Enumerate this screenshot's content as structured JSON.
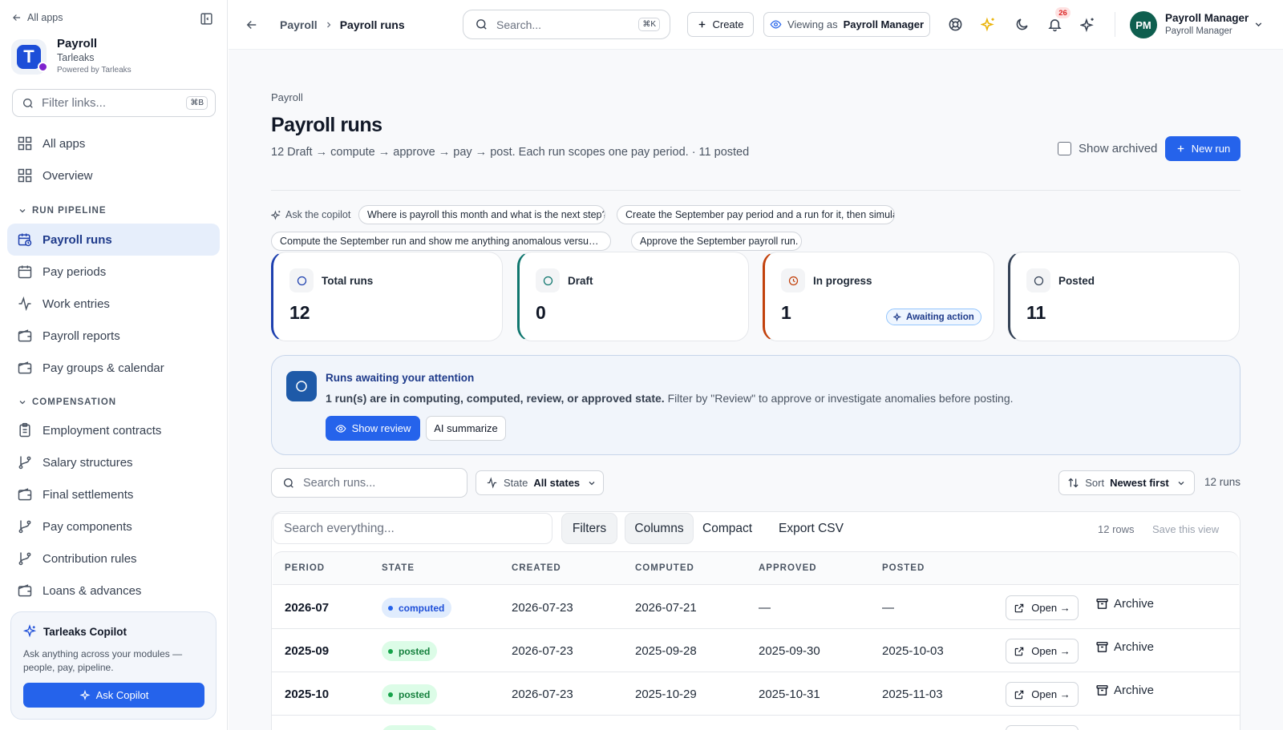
{
  "sidebar": {
    "back_label": "All apps",
    "app_name": "Payroll",
    "org_name": "Tarleaks",
    "powered_by": "Powered by Tarleaks",
    "filter_placeholder": "Filter links...",
    "filter_shortcut": "⌘B",
    "top_items": [
      {
        "label": "All apps"
      },
      {
        "label": "Overview"
      }
    ],
    "sections": [
      {
        "title": "RUN PIPELINE",
        "items": [
          {
            "label": "Payroll runs"
          },
          {
            "label": "Pay periods"
          },
          {
            "label": "Work entries"
          },
          {
            "label": "Payroll reports"
          },
          {
            "label": "Pay groups & calendar"
          }
        ]
      },
      {
        "title": "COMPENSATION",
        "items": [
          {
            "label": "Employment contracts"
          },
          {
            "label": "Salary structures"
          },
          {
            "label": "Final settlements"
          },
          {
            "label": "Pay components"
          },
          {
            "label": "Contribution rules"
          },
          {
            "label": "Loans & advances"
          }
        ]
      }
    ],
    "copilot": {
      "title": "Tarleaks Copilot",
      "description": "Ask anything across your modules — people, pay, pipeline.",
      "button": "Ask Copilot"
    }
  },
  "topbar": {
    "breadcrumb": [
      "Payroll",
      "Payroll runs"
    ],
    "search_placeholder": "Search...",
    "search_shortcut": "⌘K",
    "create_label": "Create",
    "viewing_as_label": "Viewing as",
    "viewing_as_role": "Payroll Manager",
    "notification_count": "26",
    "user": {
      "initials": "PM",
      "name": "Payroll Manager",
      "role": "Payroll Manager"
    }
  },
  "page": {
    "eyebrow": "Payroll",
    "title": "Payroll runs",
    "subtitle": "12 Draft → compute → approve → pay → post. Each run scopes one pay period. · 11 posted",
    "show_archived_label": "Show archived",
    "new_run_label": "New run"
  },
  "copilot_prompts": {
    "label": "Ask the copilot",
    "chips": [
      "Where is payroll this month and what is the next step?",
      "Create the September pay period and a run for it, then simulate.",
      "Compute the September run and show me anything anomalous versus August.",
      "Approve the September payroll run."
    ]
  },
  "stats": [
    {
      "label": "Total runs",
      "value": "12",
      "color": "#1e40af"
    },
    {
      "label": "Draft",
      "value": "0",
      "color": "#0f766e"
    },
    {
      "label": "In progress",
      "value": "1",
      "color": "#c2410c",
      "badge": "Awaiting action"
    },
    {
      "label": "Posted",
      "value": "11",
      "color": "#334155"
    }
  ],
  "attention": {
    "title": "Runs awaiting your attention",
    "bold_text": "1 run(s) are in computing, computed, review, or approved state.",
    "text": " Filter by \"Review\" to approve or investigate anomalies before posting.",
    "show_review": "Show review",
    "ai_summarize": "AI summarize"
  },
  "toolbar": {
    "search_placeholder": "Search runs...",
    "state_label": "State",
    "state_value": "All states",
    "sort_label": "Sort",
    "sort_value": "Newest first",
    "count": "12 runs"
  },
  "table": {
    "search_placeholder": "Search everything...",
    "filters": "Filters",
    "columns_btn": "Columns",
    "compact": "Compact",
    "export": "Export CSV",
    "row_count": "12 rows",
    "save_view": "Save this view",
    "columns": [
      "PERIOD",
      "STATE",
      "CREATED",
      "COMPUTED",
      "APPROVED",
      "POSTED"
    ],
    "open_label": "Open →",
    "archive_label": "Archive",
    "rows": [
      {
        "period": "2026-07",
        "state": "computed",
        "created": "2026-07-23",
        "computed": "2026-07-21",
        "approved": "—",
        "posted": "—"
      },
      {
        "period": "2025-09",
        "state": "posted",
        "created": "2026-07-23",
        "computed": "2025-09-28",
        "approved": "2025-09-30",
        "posted": "2025-10-03"
      },
      {
        "period": "2025-10",
        "state": "posted",
        "created": "2026-07-23",
        "computed": "2025-10-29",
        "approved": "2025-10-31",
        "posted": "2025-11-03"
      }
    ]
  },
  "colors": {
    "primary": "#2563eb",
    "posted_bg": "#dcfce7",
    "posted_fg": "#15803d",
    "computed_bg": "#e0ecfd",
    "computed_fg": "#1d4ed8"
  }
}
